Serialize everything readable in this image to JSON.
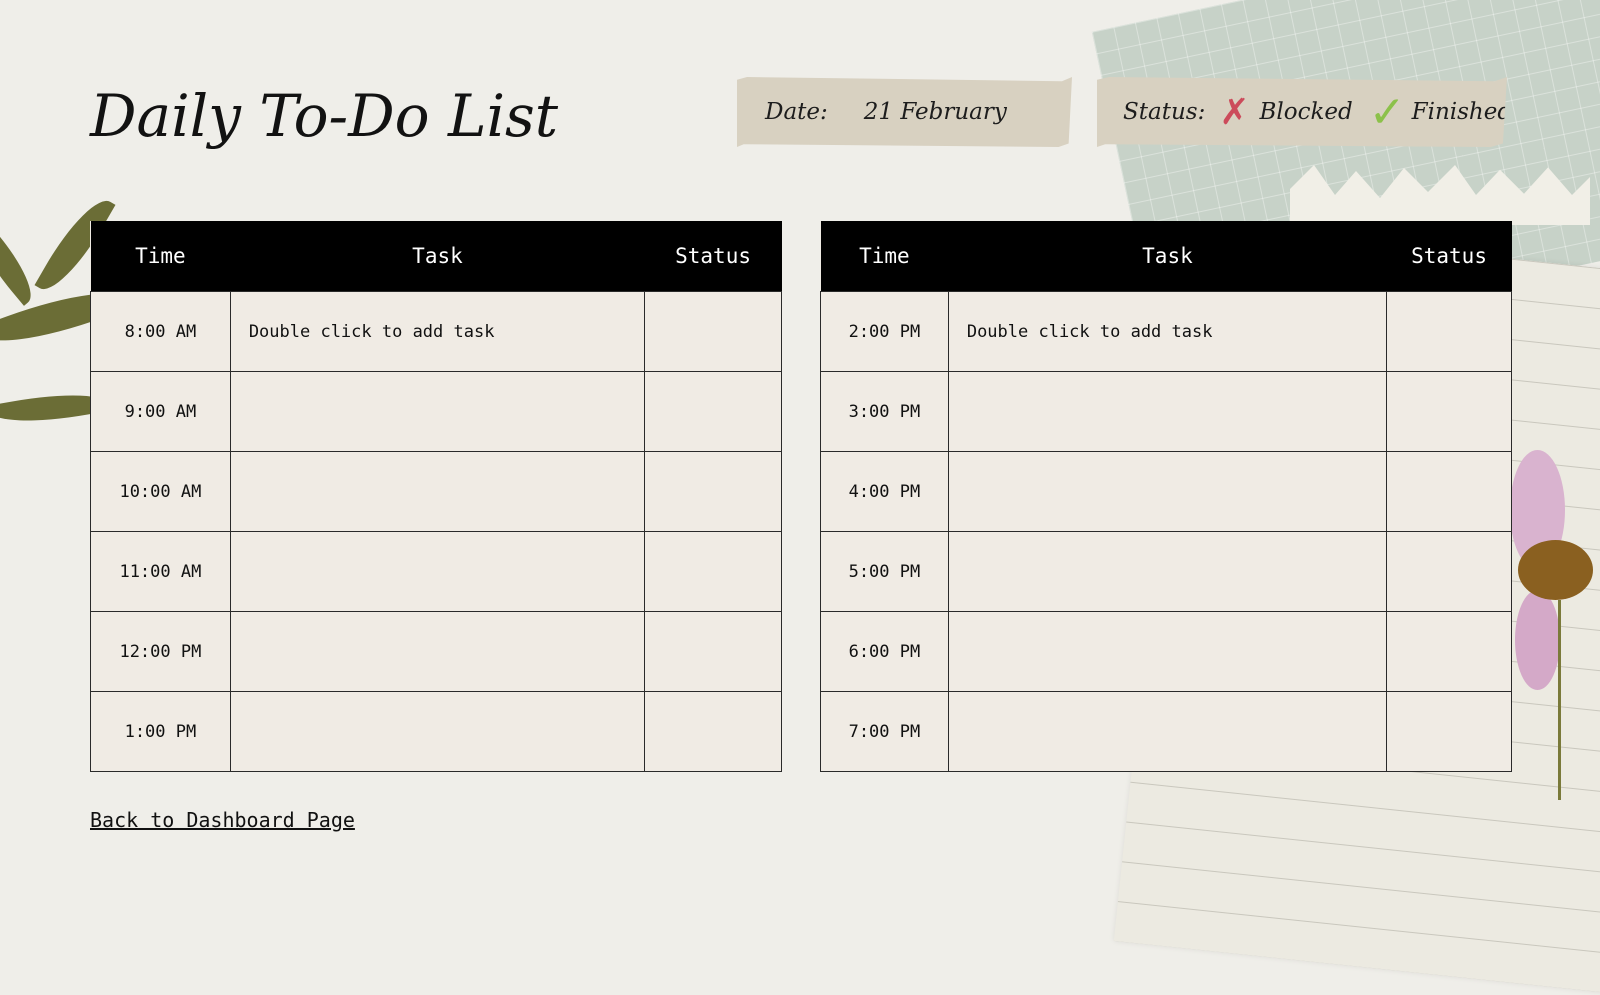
{
  "title": "Daily To-Do List",
  "date": {
    "label": "Date:",
    "value": "21 February"
  },
  "status_legend": {
    "label": "Status:",
    "blocked": "Blocked",
    "finished": "Finished",
    "blocked_color": "#cc4b5b",
    "finished_color": "#8cc14a"
  },
  "table_headers": {
    "time": "Time",
    "task": "Task",
    "status": "Status"
  },
  "morning_rows": [
    {
      "time": "8:00 AM",
      "task": "Double click to add task",
      "status": ""
    },
    {
      "time": "9:00 AM",
      "task": "",
      "status": ""
    },
    {
      "time": "10:00 AM",
      "task": "",
      "status": ""
    },
    {
      "time": "11:00 AM",
      "task": "",
      "status": ""
    },
    {
      "time": "12:00 PM",
      "task": "",
      "status": ""
    },
    {
      "time": "1:00 PM",
      "task": "",
      "status": ""
    }
  ],
  "afternoon_rows": [
    {
      "time": "2:00 PM",
      "task": "Double click to add task",
      "status": ""
    },
    {
      "time": "3:00 PM",
      "task": "",
      "status": ""
    },
    {
      "time": "4:00 PM",
      "task": "",
      "status": ""
    },
    {
      "time": "5:00 PM",
      "task": "",
      "status": ""
    },
    {
      "time": "6:00 PM",
      "task": "",
      "status": ""
    },
    {
      "time": "7:00 PM",
      "task": "",
      "status": ""
    }
  ],
  "back_link": "Back to Dashboard Page"
}
